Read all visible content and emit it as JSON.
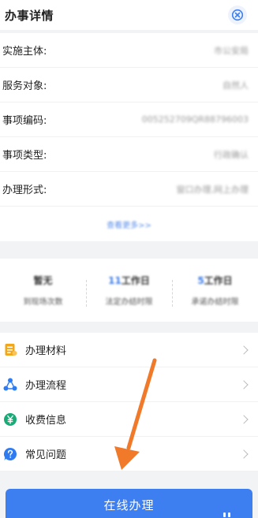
{
  "header": {
    "title": "办事详情"
  },
  "details": [
    {
      "label": "实施主体:",
      "value": "市公安局"
    },
    {
      "label": "服务对象:",
      "value": "自然人"
    },
    {
      "label": "事项编码:",
      "value": "00525270​9QR88796003"
    },
    {
      "label": "事项类型:",
      "value": "行政确认"
    },
    {
      "label": "办理形式:",
      "value": "窗口办理,网上办理"
    }
  ],
  "more_link": "查看更多>>",
  "stats": [
    {
      "value": "暂无",
      "highlight": "",
      "label": "到现场次数"
    },
    {
      "value": "工作日",
      "highlight": "11",
      "label": "法定办结时限"
    },
    {
      "value": "工作日",
      "highlight": "5",
      "label": "承诺办结时限"
    }
  ],
  "menu": [
    {
      "label": "办理材料",
      "icon": "document-icon",
      "color": "#f2a71b"
    },
    {
      "label": "办理流程",
      "icon": "flow-icon",
      "color": "#2f7cf0"
    },
    {
      "label": "收费信息",
      "icon": "yen-icon",
      "color": "#1aaa77"
    },
    {
      "label": "常见问题",
      "icon": "question-icon",
      "color": "#2f7cf0"
    }
  ],
  "primary_button": "在线办理",
  "colors": {
    "accent": "#3d7ff0",
    "annotation_arrow": "#f07a2a"
  }
}
